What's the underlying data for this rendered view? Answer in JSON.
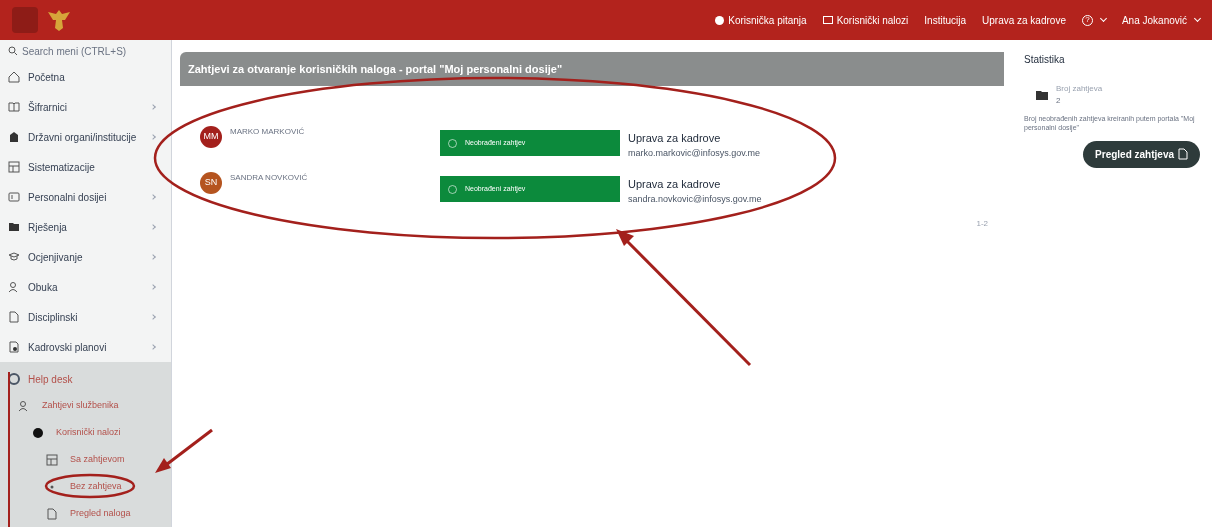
{
  "topbar": {
    "links": [
      {
        "kind": "info",
        "label": "Korisnička pitanja"
      },
      {
        "kind": "accounts",
        "label": "Korisnički nalozi"
      },
      {
        "kind": "plain",
        "label": "Institucija"
      },
      {
        "kind": "plain",
        "label": "Uprava za kadrove"
      },
      {
        "kind": "help",
        "label": "?"
      },
      {
        "kind": "user",
        "label": "Ana Jokanović"
      }
    ]
  },
  "sidebar": {
    "search": {
      "placeholder": "Search meni (CTRL+S)"
    },
    "items": [
      {
        "label": "Početna",
        "arrow": false
      },
      {
        "label": "Šifrarnici",
        "arrow": true
      },
      {
        "label": "Državni organi/institucije",
        "arrow": true
      },
      {
        "label": "Sistematizacije",
        "arrow": false
      },
      {
        "label": "Personalni dosijei",
        "arrow": true
      },
      {
        "label": "Rješenja",
        "arrow": true
      },
      {
        "label": "Ocjenjivanje",
        "arrow": true
      },
      {
        "label": "Obuka",
        "arrow": true
      },
      {
        "label": "Disciplinski",
        "arrow": true
      },
      {
        "label": "Kadrovski planovi",
        "arrow": true
      }
    ],
    "help_desk": {
      "label": "Help desk",
      "expanded": true,
      "children": [
        {
          "label": "Zahtjevi službenika",
          "children": [
            {
              "label": "Korisnički nalozi",
              "children": [
                {
                  "label": "Sa zahtjevom"
                },
                {
                  "label": "Bez zahtjeva"
                },
                {
                  "label": "Pregled naloga"
                }
              ]
            }
          ]
        }
      ]
    }
  },
  "main": {
    "title": "Zahtjevi za otvaranje korisničkih naloga - portal \"Moj personalni dosije\"",
    "requests": [
      {
        "initials": "MM",
        "color": "#a3201c",
        "name": "MARKO MARKOVIĆ",
        "button": "Neobrađeni zahtjev",
        "org": "Uprava za kadrove",
        "email": "marko.markovic@infosys.gov.me"
      },
      {
        "initials": "SN",
        "color": "#b5541f",
        "name": "SANDRA NOVKOVIĆ",
        "button": "Neobrađeni zahtjev",
        "org": "Uprava za kadrove",
        "email": "sandra.novkovic@infosys.gov.me"
      }
    ],
    "pager": "1-2"
  },
  "stats": {
    "title": "Statistika",
    "card_label": "Broj zahtjeva",
    "card_value": "2",
    "description": "Broj neobrađenih zahtjeva kreiranih putem portala \"Moj personalni dosije\"",
    "button": "Pregled zahtjeva"
  }
}
